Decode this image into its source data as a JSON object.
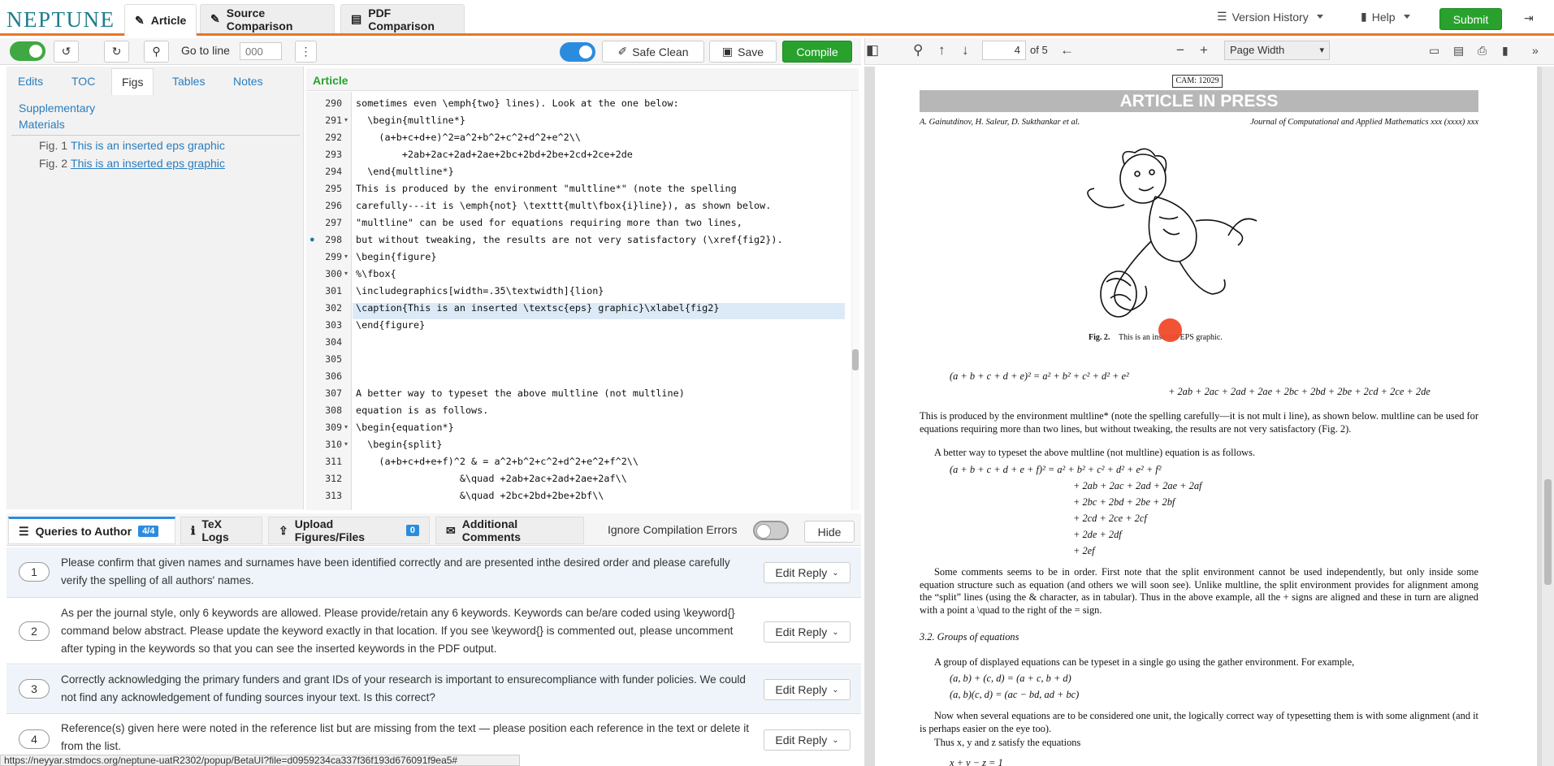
{
  "app": {
    "logo": "NEPTUNE"
  },
  "top_tabs": [
    {
      "label": "Article",
      "icon": "pencil-icon"
    },
    {
      "label": "Source Comparison",
      "icon": "pencil-icon"
    },
    {
      "label": "PDF Comparison",
      "icon": "pdf-icon"
    }
  ],
  "top_menu": {
    "version_history": "Version History",
    "help": "Help",
    "submit": "Submit"
  },
  "toolbar": {
    "goto_label": "Go to line",
    "goto_placeholder": "000",
    "safe_clean": "Safe Clean",
    "save": "Save",
    "compile": "Compile"
  },
  "side_tabs": [
    "Edits",
    "TOC",
    "Figs",
    "Tables",
    "Notes",
    "Supplementary",
    "Materials"
  ],
  "figs": [
    {
      "num": "Fig. 1",
      "title": "This is an inserted eps graphic"
    },
    {
      "num": "Fig. 2",
      "title": "This is an inserted eps graphic"
    }
  ],
  "editor": {
    "title": "Article",
    "lines": [
      {
        "n": "290",
        "t": "sometimes even \\emph{two} lines). Look at the one below:"
      },
      {
        "n": "291",
        "t": "  \\begin{multline*}"
      },
      {
        "n": "292",
        "t": "    (a+b+c+d+e)^2=a^2+b^2+c^2+d^2+e^2\\\\"
      },
      {
        "n": "293",
        "t": "        +2ab+2ac+2ad+2ae+2bc+2bd+2be+2cd+2ce+2de"
      },
      {
        "n": "294",
        "t": "  \\end{multline*}"
      },
      {
        "n": "295",
        "t": "This is produced by the environment \"multline*\" (note the spelling"
      },
      {
        "n": "296",
        "t": "carefully---it is \\emph{not} \\texttt{mult\\fbox{i}line}), as shown below."
      },
      {
        "n": "297",
        "t": "\"multline\" can be used for equations requiring more than two lines,"
      },
      {
        "n": "298",
        "t": "but without tweaking, the results are not very satisfactory (\\xref{fig2})."
      },
      {
        "n": "299",
        "t": "\\begin{figure}"
      },
      {
        "n": "300",
        "t": "%\\fbox{"
      },
      {
        "n": "301",
        "t": "\\includegraphics[width=.35\\textwidth]{lion}"
      },
      {
        "n": "302",
        "t": "\\caption{This is an inserted \\textsc{eps} graphic}\\xlabel{fig2}"
      },
      {
        "n": "303",
        "t": "\\end{figure}"
      },
      {
        "n": "304",
        "t": ""
      },
      {
        "n": "305",
        "t": ""
      },
      {
        "n": "306",
        "t": ""
      },
      {
        "n": "307",
        "t": "A better way to typeset the above multline (not multline)"
      },
      {
        "n": "308",
        "t": "equation is as follows."
      },
      {
        "n": "309",
        "t": "\\begin{equation*}"
      },
      {
        "n": "310",
        "t": "  \\begin{split}"
      },
      {
        "n": "311",
        "t": "    (a+b+c+d+e+f)^2 & = a^2+b^2+c^2+d^2+e^2+f^2\\\\"
      },
      {
        "n": "312",
        "t": "                  &\\quad +2ab+2ac+2ad+2ae+2af\\\\"
      },
      {
        "n": "313",
        "t": "                  &\\quad +2bc+2bd+2be+2bf\\\\"
      }
    ]
  },
  "bottom_tabs": [
    {
      "label": "Queries to Author",
      "badge": "4/4"
    },
    {
      "label": "TeX Logs"
    },
    {
      "label": "Upload Figures/Files",
      "badge": "0"
    },
    {
      "label": "Additional Comments"
    }
  ],
  "ignore_errors": "Ignore Compilation Errors",
  "hide": "Hide",
  "queries": [
    {
      "n": "1",
      "text": "Please confirm that given names and surnames have been identified correctly and are presented inthe desired order and please carefully verify the spelling of all authors' names."
    },
    {
      "n": "2",
      "text": "As per the journal style, only 6 keywords are allowed. Please provide/retain any 6 keywords. Keywords can be/are coded using \\keyword{} command below abstract. Please update the keyword exactly in that location. If you see \\keyword{} is commented out, please uncomment after typing in the keywords so that you can see the inserted keywords in the PDF output."
    },
    {
      "n": "3",
      "text": "Correctly acknowledging the primary funders and grant IDs of your research is important to ensurecompliance with funder policies. We could not find any acknowledgement of funding sources inyour text. Is this correct?"
    },
    {
      "n": "4",
      "text": "Reference(s) given here were noted in the reference list but are missing from the text — please position each reference in the text or delete it from the list."
    }
  ],
  "edit_reply": "Edit Reply",
  "status_url": "https://neyyar.stmdocs.org/neptune-uatR2302/popup/BetaUI?file=d0959234ca337f36f193d676091f9ea5#",
  "pdf": {
    "page": "4",
    "of": "of 5",
    "zoom": "Page Width",
    "cam": "CAM: 12029",
    "banner": "ARTICLE IN PRESS",
    "authors": "A. Gainutdinov, H. Saleur, D. Sukthankar et al.",
    "journal": "Journal of Computational and Applied Mathematics xxx (xxxx) xxx",
    "fig_caption_label": "Fig. 2.",
    "fig_caption": "This is an inserted EPS graphic.",
    "eq1a": "(a + b + c + d + e)² = a² + b² + c² + d² + e²",
    "eq1b": "+ 2ab + 2ac + 2ad + 2ae + 2bc + 2bd + 2be + 2cd + 2ce + 2de",
    "p1": "This is produced by the environment multline* (note the spelling carefully—it is not mult i line), as shown below. multline can be used for equations requiring more than two lines, but without tweaking, the results are not very satisfactory (Fig. 2).",
    "p2": "A better way to typeset the above multline (not multline) equation is as follows.",
    "eq2": [
      "(a + b + c + d + e + f)² = a² + b² + c² + d² + e² + f²",
      "+ 2ab + 2ac + 2ad + 2ae + 2af",
      "+ 2bc + 2bd + 2be + 2bf",
      "+ 2cd + 2ce + 2cf",
      "+ 2de + 2df",
      "+ 2ef"
    ],
    "p3": "Some comments seems to be in order. First note that the split environment cannot be used independently, but only inside some equation structure such as equation (and others we will soon see). Unlike multline, the split environment provides for alignment among the “split” lines (using the & character, as in tabular). Thus in the above example, all the + signs are aligned and these in turn are aligned with a point a \\quad to the right of the = sign.",
    "section": "3.2.  Groups of equations",
    "p4": "A group of displayed equations can be typeset in a single go using the gather environment. For example,",
    "eq3": [
      "(a, b) + (c, d) = (a + c, b + d)",
      "(a, b)(c, d) = (ac − bd, ad + bc)"
    ],
    "p5": "Now when several equations are to be considered one unit, the logically correct way of typesetting them is with some alignment (and it is perhaps easier on the eye too).",
    "p6": "Thus x, y and z satisfy the equations",
    "p7": "x + y − z = 1"
  }
}
